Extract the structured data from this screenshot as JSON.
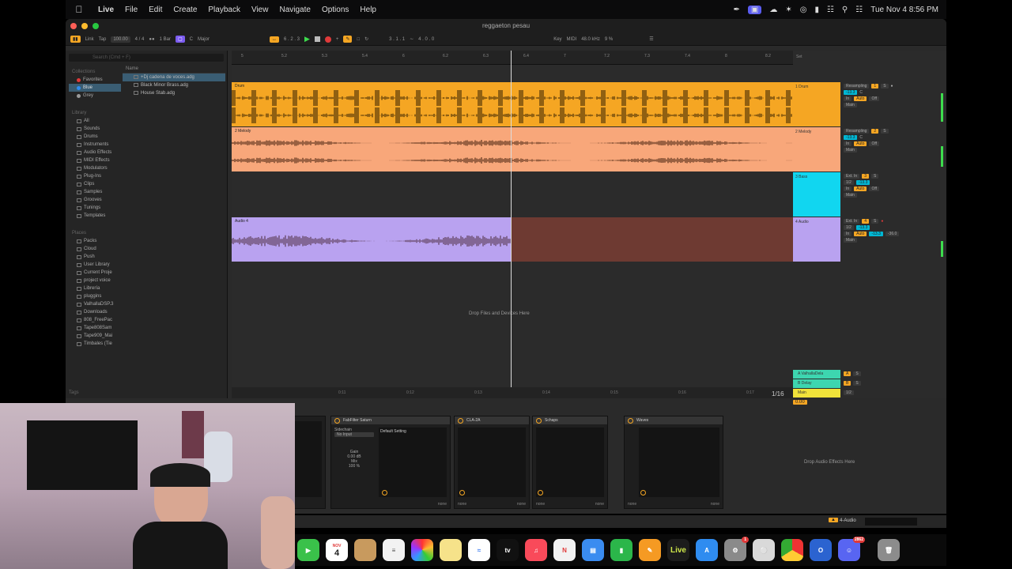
{
  "menubar": {
    "app": "Live",
    "items": [
      "File",
      "Edit",
      "Create",
      "Playback",
      "View",
      "Navigate",
      "Options",
      "Help"
    ],
    "datetime": "Tue Nov 4  8:56 PM"
  },
  "window": {
    "title": "reggaeton pesau"
  },
  "control_bar": {
    "link": "Link",
    "tap": "Tap",
    "tempo": "100.00",
    "signature": "4 / 4",
    "quantize": "1 Bar",
    "key": "C",
    "scale": "Major",
    "position": "6 . 2 . 3",
    "loop_start": "3 . 1 . 1",
    "loop_length": "4 . 0 . 0",
    "key_label": "Key",
    "midi_label": "MIDI",
    "sample_rate": "48.0 kHz",
    "cpu": "9 %"
  },
  "browser": {
    "search_placeholder": "Search (Cmd + F)",
    "collections_label": "Collections",
    "collections": [
      "Favorites",
      "Blue",
      "Grey"
    ],
    "library_label": "Library",
    "library": [
      "All",
      "Sounds",
      "Drums",
      "Instruments",
      "Audio Effects",
      "MIDI Effects",
      "Modulators",
      "Plug-Ins",
      "Clips",
      "Samples",
      "Grooves",
      "Tunings",
      "Templates"
    ],
    "places_label": "Places",
    "places": [
      "Packs",
      "Cloud",
      "Push",
      "User Library",
      "Current Proje",
      "project voice",
      "Librería",
      "pluggins",
      "ValhallaDSP.3",
      "Downloads",
      "808_FreePac",
      "Tape808Sam",
      "Tape909_Mai",
      "Timbales (Tie"
    ],
    "name_header": "Name",
    "files": [
      "+Dj cadena de voces.adg",
      "Black Minor Brass.adg",
      "House Stab.adg"
    ],
    "tags_label": "Tags"
  },
  "ruler": {
    "marks": [
      "5",
      "5.2",
      "5.3",
      "5.4",
      "6",
      "6.2",
      "6.3",
      "6.4",
      "7",
      "7.2",
      "7.3",
      "7.4",
      "8",
      "8.2"
    ],
    "set_label": "Set"
  },
  "tracks": [
    {
      "clip": "Drum",
      "head": "1 Drum",
      "input": "Resampling",
      "number": "1",
      "color": "#f5a623"
    },
    {
      "clip": "2 Melody",
      "head": "2 Melody",
      "input": "Resampling",
      "number": "2",
      "color": "#f8a77a"
    },
    {
      "clip": "",
      "head": "3 Bass",
      "input": "Ext. In",
      "number": "3",
      "color": "#11d6f0"
    },
    {
      "clip": "Audio 4",
      "head": "4 Audio",
      "input": "Ext. In",
      "number": "4",
      "color": "#b9a2f0"
    }
  ],
  "mixer": {
    "monitor_in": "In",
    "monitor_auto": "Auto",
    "monitor_off": "Off",
    "output": "Main",
    "channel": "1/2",
    "vol_a": "-13.3",
    "vol_b": "-36.0"
  },
  "returns": [
    "A ValhallaDela",
    "B Delay",
    "Main"
  ],
  "main_tempo": "0.00",
  "drop_files_msg": "Drop Files and Devices Here",
  "time_marks": [
    "0:11",
    "0:12",
    "0:13",
    "0:14",
    "0:15",
    "0:16",
    "0:17"
  ],
  "counter": "1/16",
  "devices": [
    {
      "name": "FabFilter Saturn",
      "preset": "Default Setting",
      "sidechain": "Sidechain",
      "input": "No Input",
      "gain_label": "Gain",
      "gain": "0.00 dB",
      "mix_label": "Mix",
      "mix": "100 %"
    },
    {
      "name": "CLA-2A",
      "preset": ""
    },
    {
      "name": "Schaps",
      "preset": ""
    },
    {
      "name": "Waves",
      "preset": ""
    }
  ],
  "device_none": "none",
  "drop_audio_fx": "Drop Audio Effects Here",
  "statusbar": {
    "track": "4-Audio"
  },
  "dock": {
    "calendar_month": "NOV",
    "calendar_day": "4",
    "live_label": "Live",
    "badge_settings": "1",
    "badge_discord": "2862"
  }
}
